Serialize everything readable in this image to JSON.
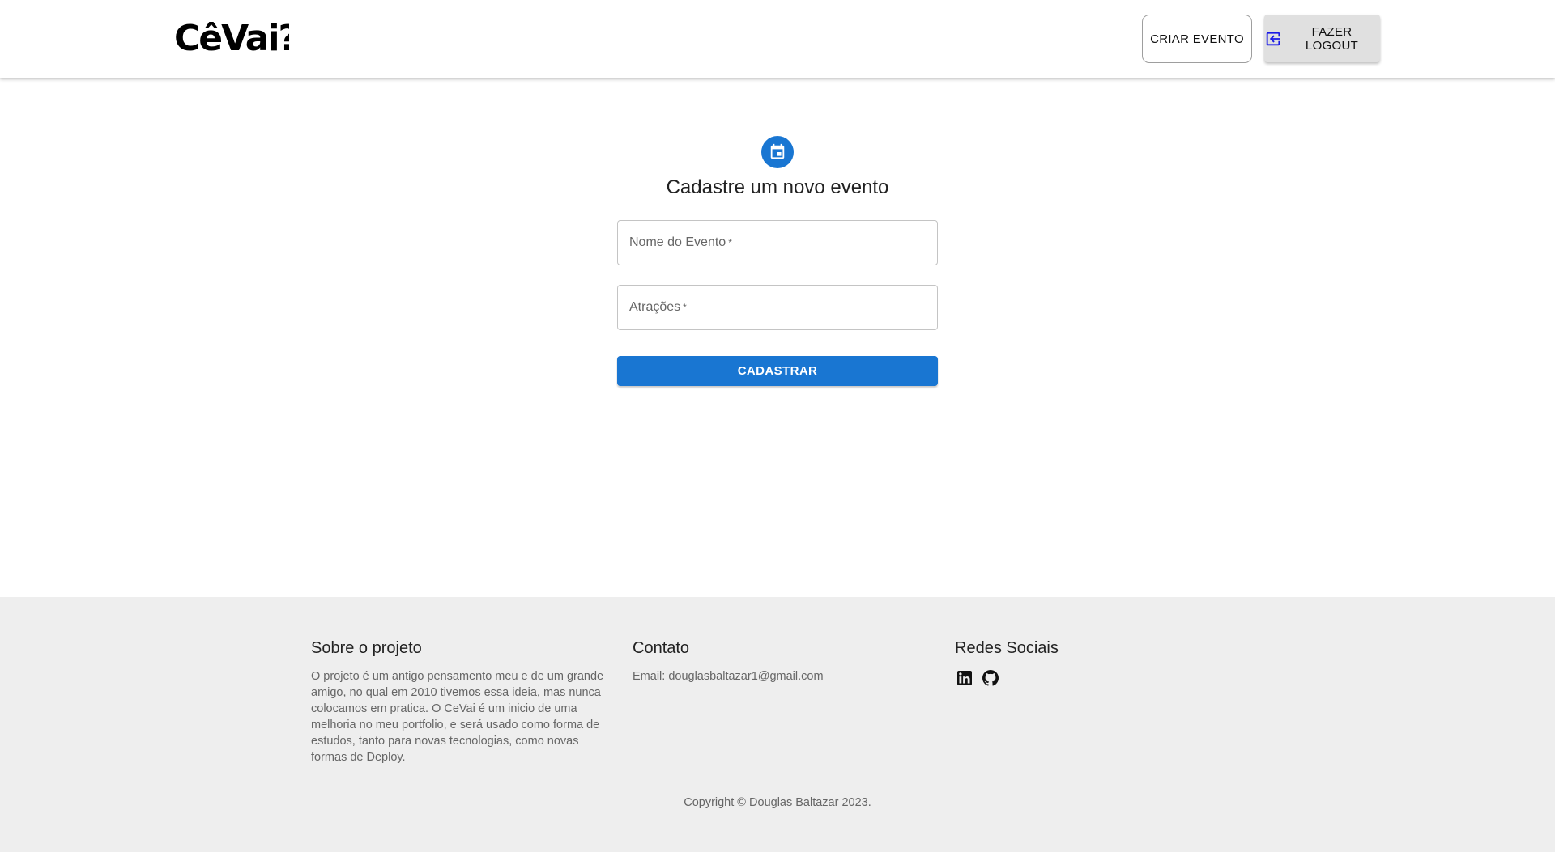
{
  "header": {
    "logo_text": "CêVai?",
    "criar_evento_label": "CRIAR EVENTO",
    "logout_label": "FAZER LOGOUT",
    "logout_icon": "logout-icon"
  },
  "form": {
    "avatar_icon": "event-calendar-icon",
    "title": "Cadastre um novo evento",
    "fields": [
      {
        "label": "Nome do Evento",
        "required_mark": "*",
        "value": ""
      },
      {
        "label": "Atrações",
        "required_mark": "*",
        "value": ""
      }
    ],
    "submit_label": "CADASTRAR"
  },
  "footer": {
    "sobre": {
      "title": "Sobre o projeto",
      "text": "O projeto é um antigo pensamento meu e de um grande amigo, no qual em 2010 tivemos essa ideia, mas nunca colocamos em pratica. O CeVai é um inicio de uma melhoria no meu portfolio, e será usado como forma de estudos, tanto para novas tecnologias, como novas formas de Deploy."
    },
    "contato": {
      "title": "Contato",
      "email": "Email: douglasbaltazar1@gmail.com"
    },
    "redes": {
      "title": "Redes Sociais",
      "icons": [
        "linkedin-icon",
        "github-icon"
      ]
    },
    "copyright": {
      "prefix": "Copyright © ",
      "link_text": "Douglas Baltazar",
      "suffix": " 2023."
    }
  },
  "colors": {
    "primary": "#1976d2",
    "footer_bg": "#eeeeee",
    "logout_icon": "#1a1ae6"
  }
}
